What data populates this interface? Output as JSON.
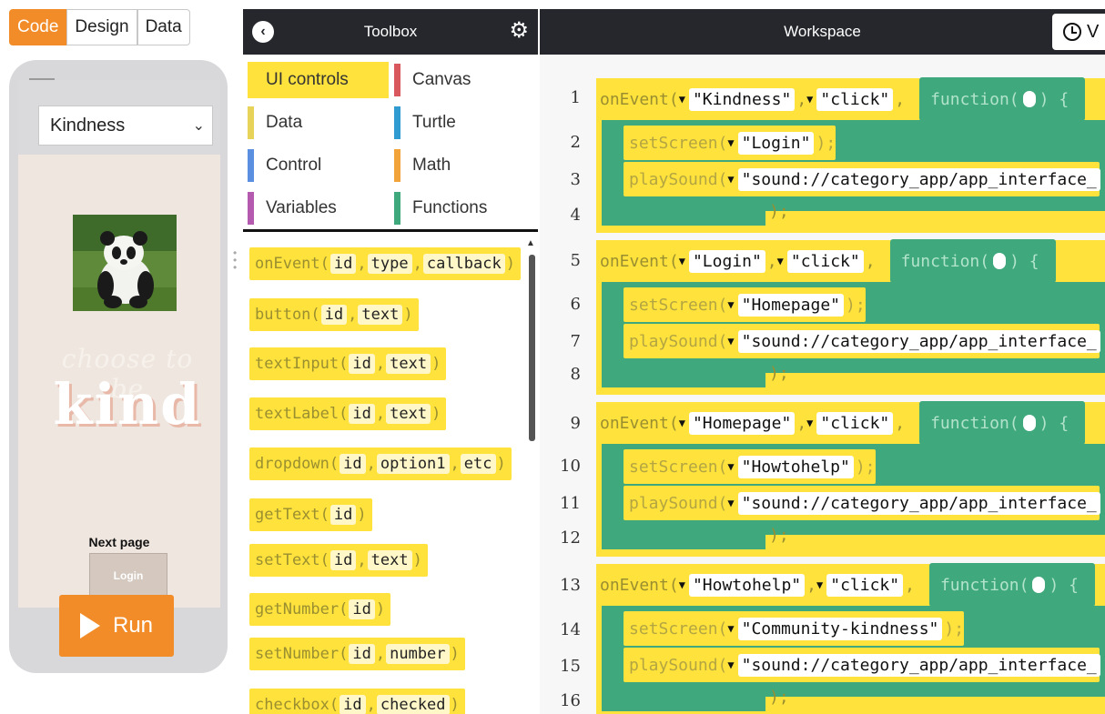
{
  "mode_tabs": [
    "Code",
    "Design",
    "Data"
  ],
  "app_preview": {
    "dropdown_value": "Kindness",
    "script_text": "choose to be",
    "headline": "kind",
    "next_page_label": "Next page",
    "login_button": "Login"
  },
  "run_button": "Run",
  "toolbox": {
    "title": "Toolbox",
    "categories": [
      {
        "label": "UI controls",
        "color": "#ffe23c"
      },
      {
        "label": "Canvas",
        "color": "#d9585e"
      },
      {
        "label": "Data",
        "color": "#e8d35a"
      },
      {
        "label": "Turtle",
        "color": "#2f9bd1"
      },
      {
        "label": "Control",
        "color": "#5b8fe0"
      },
      {
        "label": "Math",
        "color": "#f2a33a"
      },
      {
        "label": "Variables",
        "color": "#b45bb0"
      },
      {
        "label": "Functions",
        "color": "#3fa87c"
      }
    ],
    "blocks": [
      {
        "name": "onEvent",
        "params": [
          "id",
          "type",
          "callback"
        ]
      },
      {
        "name": "button",
        "params": [
          "id",
          "text"
        ]
      },
      {
        "name": "textInput",
        "params": [
          "id",
          "text"
        ]
      },
      {
        "name": "textLabel",
        "params": [
          "id",
          "text"
        ]
      },
      {
        "name": "dropdown",
        "params": [
          "id",
          "option1",
          "etc"
        ]
      },
      {
        "name": "getText",
        "params": [
          "id"
        ]
      },
      {
        "name": "setText",
        "params": [
          "id",
          "text"
        ]
      },
      {
        "name": "getNumber",
        "params": [
          "id"
        ]
      },
      {
        "name": "setNumber",
        "params": [
          "id",
          "number"
        ]
      },
      {
        "name": "checkbox",
        "params": [
          "id",
          "checked"
        ]
      }
    ]
  },
  "workspace": {
    "title": "Workspace",
    "version_label": "V",
    "line_numbers": [
      "1",
      "2",
      "3",
      "4",
      "5",
      "6",
      "7",
      "8",
      "9",
      "10",
      "11",
      "12",
      "13",
      "14",
      "15",
      "16"
    ],
    "events": [
      {
        "id": "\"Kindness\"",
        "type": "\"click\"",
        "screen": "\"Login\"",
        "sound": "\"sound://category_app/app_interface_"
      },
      {
        "id": "\"Login\"",
        "type": "\"click\"",
        "screen": "\"Homepage\"",
        "sound": "\"sound://category_app/app_interface_"
      },
      {
        "id": "\"Homepage\"",
        "type": "\"click\"",
        "screen": "\"Howtohelp\"",
        "sound": "\"sound://category_app/app_interface_"
      },
      {
        "id": "\"Howtohelp\"",
        "type": "\"click\"",
        "screen": "\"Community-kindness\"",
        "sound": "\"sound://category_app/app_interface_"
      }
    ],
    "keywords": {
      "on_event": "onEvent",
      "function": "function",
      "set_screen": "setScreen",
      "play_sound": "playSound"
    }
  },
  "colors": {
    "accent_orange": "#f28c28",
    "block_yellow": "#ffe23c",
    "block_green": "#3fa87c",
    "header_dark": "#25272d"
  }
}
